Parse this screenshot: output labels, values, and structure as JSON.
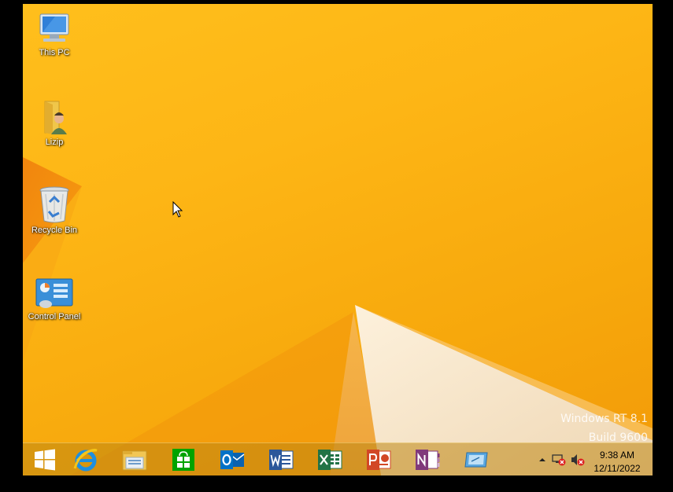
{
  "desktop": {
    "icons": [
      {
        "label": "This PC",
        "icon": "this-pc-icon"
      },
      {
        "label": "Lizip",
        "icon": "user-folder-icon"
      },
      {
        "label": "Recycle Bin",
        "icon": "recycle-bin-icon"
      },
      {
        "label": "Control Panel",
        "icon": "control-panel-icon"
      }
    ],
    "watermark": {
      "line1": "Windows RT 8.1",
      "line2": "Build 9600"
    }
  },
  "taskbar": {
    "pinned": [
      {
        "app": "Start",
        "icon": "windows-start-icon"
      },
      {
        "app": "Internet Explorer",
        "icon": "internet-explorer-icon"
      },
      {
        "app": "File Explorer",
        "icon": "file-explorer-icon"
      },
      {
        "app": "Store",
        "icon": "store-icon"
      },
      {
        "app": "Outlook",
        "icon": "outlook-icon"
      },
      {
        "app": "Word",
        "icon": "word-icon"
      },
      {
        "app": "Excel",
        "icon": "excel-icon"
      },
      {
        "app": "PowerPoint",
        "icon": "powerpoint-icon"
      },
      {
        "app": "OneNote",
        "icon": "onenote-icon"
      },
      {
        "app": "Remote Desktop",
        "icon": "remote-desktop-icon"
      }
    ],
    "tray": {
      "time": "9:38 AM",
      "date": "12/11/2022",
      "icons": [
        "show-hidden-icons-chevron-icon",
        "network-disconnected-icon",
        "volume-muted-icon"
      ]
    }
  },
  "colors": {
    "wallpaper": "#fdb515",
    "taskbar": "#be8714",
    "word": "#2b579a",
    "excel": "#217346",
    "powerpoint": "#d24726",
    "onenote": "#80397b",
    "outlook": "#0072c6",
    "store": "#00a300"
  }
}
